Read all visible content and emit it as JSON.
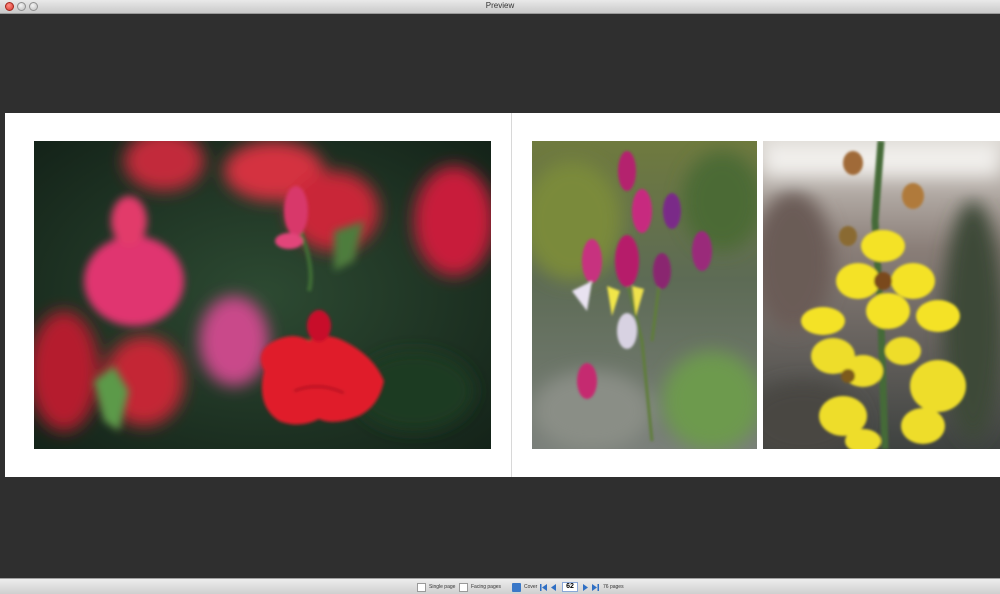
{
  "window": {
    "title": "Preview"
  },
  "viewer": {
    "photos": [
      {
        "subject": "red and pink salvia flowers"
      },
      {
        "subject": "purple and white flower buds"
      },
      {
        "subject": "yellow mullein flowers"
      }
    ]
  },
  "toolbar": {
    "single_page_label": "Single page",
    "facing_pages_label": "Facing pages",
    "cover_label": "Cover",
    "page_number": "62",
    "page_count_label": "76 pages"
  },
  "colors": {
    "canvas": "#2f2f2f",
    "page": "#ffffff",
    "accent": "#3a78c8"
  }
}
